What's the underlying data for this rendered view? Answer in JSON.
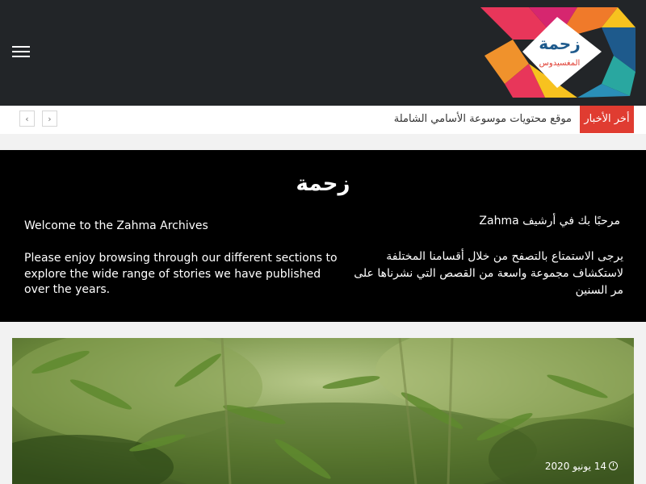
{
  "header": {
    "menu_icon": "hamburger-menu-icon",
    "logo_text": "زحمة",
    "logo_subtext": "المغسيدوس",
    "logo_colors": [
      "#e8365a",
      "#f0922c",
      "#f7c21f",
      "#2a8fb8",
      "#1e5a8c",
      "#29a7a0"
    ]
  },
  "ticker": {
    "latest_label": "أخر الأخبار",
    "headline": "موقع محتويات موسوعة الأسامي الشاملة",
    "prev_icon": "chevron-left-icon",
    "next_icon": "chevron-right-icon",
    "prev_glyph": "‹",
    "next_glyph": "›",
    "accent": "#e03c31"
  },
  "banner": {
    "logo_text": "زحمة",
    "en_title": "Welcome to the Zahma Archives",
    "en_body": "Please enjoy browsing through our different sections to explore the wide range of stories we have published over the years.",
    "ar_title": "مرحبًا بك في أرشيف Zahma",
    "ar_body": "يرجى الاستمتاع بالتصفح من خلال أقسامنا المختلفة لاستكشاف مجموعة واسعة من القصص التي نشرناها على مر السنين"
  },
  "featured": {
    "date": "14 يونيو 2020",
    "date_icon": "clock-icon"
  }
}
